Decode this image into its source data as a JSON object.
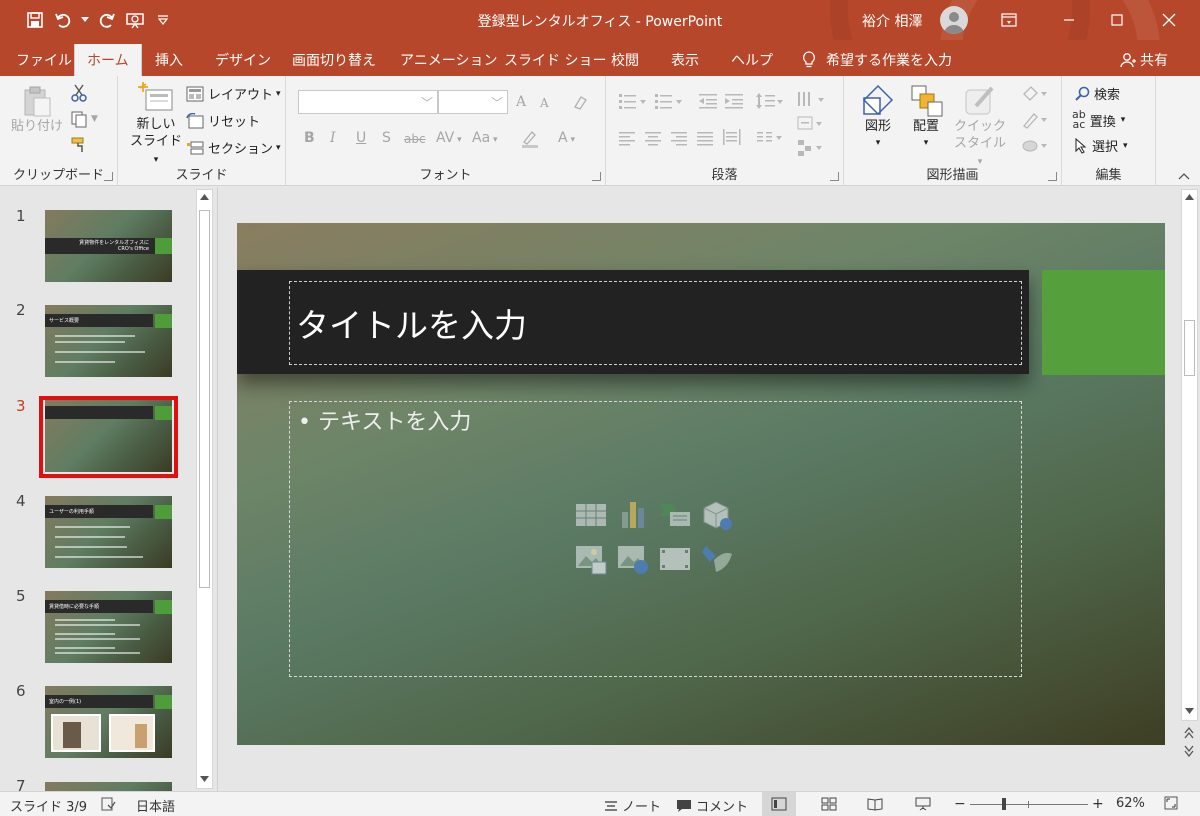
{
  "titlebar": {
    "title": "登録型レンタルオフィス  -  PowerPoint",
    "user_name": "裕介 相澤",
    "icons": [
      "save-icon",
      "undo-icon",
      "redo-icon",
      "present-from-start-icon",
      "customize-qat-icon"
    ]
  },
  "tabs": [
    "ファイル",
    "ホーム",
    "挿入",
    "デザイン",
    "画面切り替え",
    "アニメーション",
    "スライド ショー",
    "校閲",
    "表示",
    "ヘルプ"
  ],
  "active_tab": "ホーム",
  "tell_me": "希望する作業を入力",
  "share": "共有",
  "ribbon": {
    "clipboard": {
      "label": "クリップボード",
      "paste": "貼り付け"
    },
    "slides": {
      "label": "スライド",
      "new_slide_1": "新しい",
      "new_slide_2": "スライド",
      "layout": "レイアウト",
      "reset": "リセット",
      "section": "セクション"
    },
    "font": {
      "label": "フォント",
      "bold": "B",
      "italic": "I",
      "underline": "U",
      "shadow": "S",
      "strike": "abc",
      "spacing": "AV",
      "case": "Aa",
      "grow": "A",
      "shrink": "A",
      "color": "A"
    },
    "paragraph": {
      "label": "段落"
    },
    "drawing": {
      "label": "図形描画",
      "shapes": "図形",
      "arrange": "配置",
      "quick_style_1": "クイック",
      "quick_style_2": "スタイル"
    },
    "editing": {
      "label": "編集",
      "find": "検索",
      "replace": "置換",
      "select": "選択"
    }
  },
  "thumbnails": [
    {
      "num": "1",
      "title": "賃貸物件をレンタルオフィスに",
      "subtitle": "CRO's Office"
    },
    {
      "num": "2",
      "title": "サービス概要"
    },
    {
      "num": "3",
      "title": ""
    },
    {
      "num": "4",
      "title": "ユーザーの利用手順"
    },
    {
      "num": "5",
      "title": "賃貸借時に必要な手順"
    },
    {
      "num": "6",
      "title": "室内の一例(1)"
    },
    {
      "num": "7",
      "title": ""
    }
  ],
  "active_slide": 3,
  "slide": {
    "title_placeholder": "タイトルを入力",
    "body_placeholder": "テキストを入力"
  },
  "statusbar": {
    "slide_counter": "スライド 3/9",
    "language": "日本語",
    "notes": "ノート",
    "comments": "コメント",
    "zoom_level": "62%",
    "zoom_minus": "−",
    "zoom_plus": "+"
  },
  "zoom_percent": 62,
  "colors": {
    "brand": "#b7472a",
    "slide_accent_green": "#55a03c",
    "selection_red": "#e01010"
  }
}
